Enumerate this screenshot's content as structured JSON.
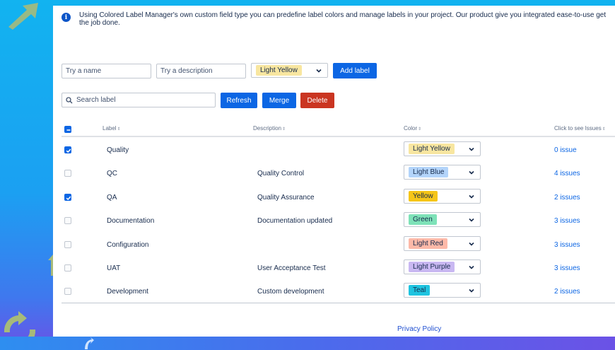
{
  "info": {
    "text": "Using Colored Label Manager's own custom field type you can predefine label colors and manage labels in your project. Our product give you integrated ease-to-use get the job done."
  },
  "new_label": {
    "name_placeholder": "Try a name",
    "description_placeholder": "Try a description",
    "color": "Light Yellow",
    "color_hex": "#f8e6a0",
    "add_label": "Add label"
  },
  "toolbar": {
    "search_placeholder": "Search label",
    "refresh": "Refresh",
    "merge": "Merge",
    "delete": "Delete"
  },
  "colors": {
    "primary": "#0c66e4",
    "danger": "#ca3521",
    "link": "#0c66e4"
  },
  "table": {
    "headers": {
      "label": "Label",
      "description": "Description",
      "color": "Color",
      "issues": "Click to see Issues"
    },
    "select_all_checked": true,
    "rows": [
      {
        "checked": true,
        "label": "Quality",
        "description": "",
        "color": "Light Yellow",
        "color_hex": "#f8e6a0",
        "issues": "0 issue"
      },
      {
        "checked": false,
        "label": "QC",
        "description": "Quality Control",
        "color": "Light Blue",
        "color_hex": "#b3d4fa",
        "issues": "4 issues"
      },
      {
        "checked": true,
        "label": "QA",
        "description": "Quality Assurance",
        "color": "Yellow",
        "color_hex": "#f5c518",
        "issues": "2 issues"
      },
      {
        "checked": false,
        "label": "Documentation",
        "description": "Documentation updated",
        "color": "Green",
        "color_hex": "#7ee2b8",
        "issues": "3 issues"
      },
      {
        "checked": false,
        "label": "Configuration",
        "description": "",
        "color": "Light Red",
        "color_hex": "#fdb9a8",
        "issues": "3 issues"
      },
      {
        "checked": false,
        "label": "UAT",
        "description": "User Acceptance Test",
        "color": "Light Purple",
        "color_hex": "#c9b8f2",
        "issues": "3 issues"
      },
      {
        "checked": false,
        "label": "Development",
        "description": "Custom development",
        "color": "Teal",
        "color_hex": "#1fc4e0",
        "issues": "2 issues"
      }
    ]
  },
  "footer": {
    "privacy": "Privacy Policy"
  }
}
